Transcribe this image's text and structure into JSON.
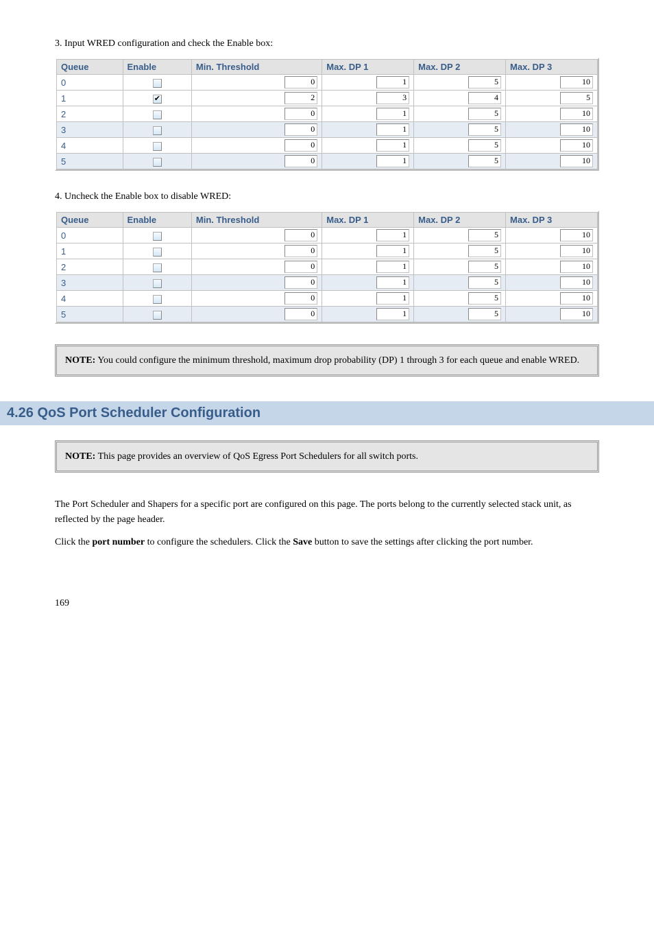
{
  "table1": {
    "intro": "3. Input WRED configuration and check the Enable box:",
    "headers": [
      "Queue",
      "Enable",
      "Min. Threshold",
      "Max. DP 1",
      "Max. DP 2",
      "Max. DP 3"
    ],
    "rows": [
      {
        "queue": "0",
        "enable": false,
        "min": "0",
        "dp1": "1",
        "dp2": "5",
        "dp3": "10",
        "stripe": false
      },
      {
        "queue": "1",
        "enable": true,
        "min": "2",
        "dp1": "3",
        "dp2": "4",
        "dp3": "5",
        "stripe": false
      },
      {
        "queue": "2",
        "enable": false,
        "min": "0",
        "dp1": "1",
        "dp2": "5",
        "dp3": "10",
        "stripe": false
      },
      {
        "queue": "3",
        "enable": false,
        "min": "0",
        "dp1": "1",
        "dp2": "5",
        "dp3": "10",
        "stripe": true
      },
      {
        "queue": "4",
        "enable": false,
        "min": "0",
        "dp1": "1",
        "dp2": "5",
        "dp3": "10",
        "stripe": false
      },
      {
        "queue": "5",
        "enable": false,
        "min": "0",
        "dp1": "1",
        "dp2": "5",
        "dp3": "10",
        "stripe": true
      }
    ]
  },
  "step4": "4. Uncheck the Enable box to disable WRED:",
  "table2": {
    "headers": [
      "Queue",
      "Enable",
      "Min. Threshold",
      "Max. DP 1",
      "Max. DP 2",
      "Max. DP 3"
    ],
    "rows": [
      {
        "queue": "0",
        "enable": false,
        "min": "0",
        "dp1": "1",
        "dp2": "5",
        "dp3": "10",
        "stripe": false
      },
      {
        "queue": "1",
        "enable": false,
        "min": "0",
        "dp1": "1",
        "dp2": "5",
        "dp3": "10",
        "stripe": false
      },
      {
        "queue": "2",
        "enable": false,
        "min": "0",
        "dp1": "1",
        "dp2": "5",
        "dp3": "10",
        "stripe": false
      },
      {
        "queue": "3",
        "enable": false,
        "min": "0",
        "dp1": "1",
        "dp2": "5",
        "dp3": "10",
        "stripe": true
      },
      {
        "queue": "4",
        "enable": false,
        "min": "0",
        "dp1": "1",
        "dp2": "5",
        "dp3": "10",
        "stripe": false
      },
      {
        "queue": "5",
        "enable": false,
        "min": "0",
        "dp1": "1",
        "dp2": "5",
        "dp3": "10",
        "stripe": true
      }
    ]
  },
  "note1": {
    "label": "NOTE:",
    "text": " You could configure the minimum threshold, maximum drop probability (DP) 1 through 3 for each queue and enable WRED."
  },
  "section": "4.26   QoS Port Scheduler Configuration",
  "note2": {
    "label": "NOTE:",
    "text": " This page provides an overview of QoS Egress Port Schedulers for all switch ports."
  },
  "body": {
    "p1": "The Port Scheduler and Shapers for a specific port are configured on this page. The ports belong to the currently selected stack unit, as reflected by the page header.",
    "p2_prefix": "Click the ",
    "p2_link": "port number",
    "p2_mid": " to configure the schedulers. Click the ",
    "p2_btn": "Save",
    "p2_suffix": " button to save the settings after clicking the port number."
  },
  "page_num": "169"
}
